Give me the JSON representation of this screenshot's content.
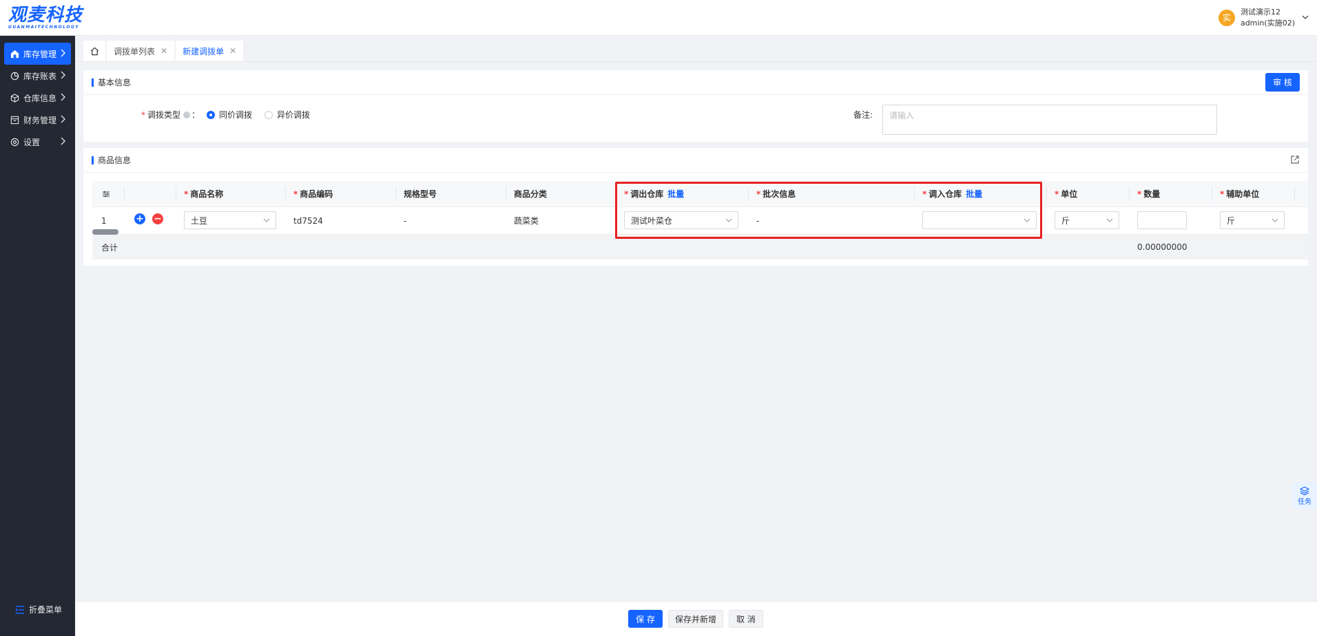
{
  "header": {
    "logo_text": "观麦科技",
    "logo_sub": "GUANMAITECHNOLOGY",
    "user": {
      "avatar_char": "实",
      "name": "测试演示12",
      "account": "admin(实施02)"
    }
  },
  "sidebar": {
    "items": [
      {
        "label": "库存管理",
        "active": true
      },
      {
        "label": "库存账表"
      },
      {
        "label": "仓库信息"
      },
      {
        "label": "财务管理"
      },
      {
        "label": "设置"
      }
    ],
    "collapse_label": "折叠菜单"
  },
  "tabs": [
    {
      "label": "调拨单列表"
    },
    {
      "label": "新建调拨单",
      "active": true
    }
  ],
  "basic": {
    "title": "基本信息",
    "audit_label": "审 核",
    "type_label": "调拨类型",
    "type_suffix": "：",
    "option1": "同价调拨",
    "option2": "异价调拨",
    "remark_label": "备注:",
    "remark_placeholder": "请输入"
  },
  "goods": {
    "title": "商品信息",
    "columns": {
      "name": "商品名称",
      "code": "商品编码",
      "spec": "规格型号",
      "category": "商品分类",
      "out_wh": "调出仓库",
      "batch": "批次信息",
      "in_wh": "调入仓库",
      "unit": "单位",
      "qty": "数量",
      "aux_unit": "辅助单位",
      "bulk_link": "批量"
    },
    "row": {
      "index": "1",
      "name": "土豆",
      "code": "td7524",
      "spec": "-",
      "category": "蔬菜类",
      "out_wh": "测试叶菜仓",
      "batch": "-",
      "in_wh": "",
      "unit": "斤",
      "qty": "",
      "aux_unit": "斤"
    },
    "total_label": "合计",
    "total_qty": "0.00000000"
  },
  "task_label": "任务",
  "footer": {
    "save": "保 存",
    "save_new": "保存并新增",
    "cancel": "取 消"
  }
}
